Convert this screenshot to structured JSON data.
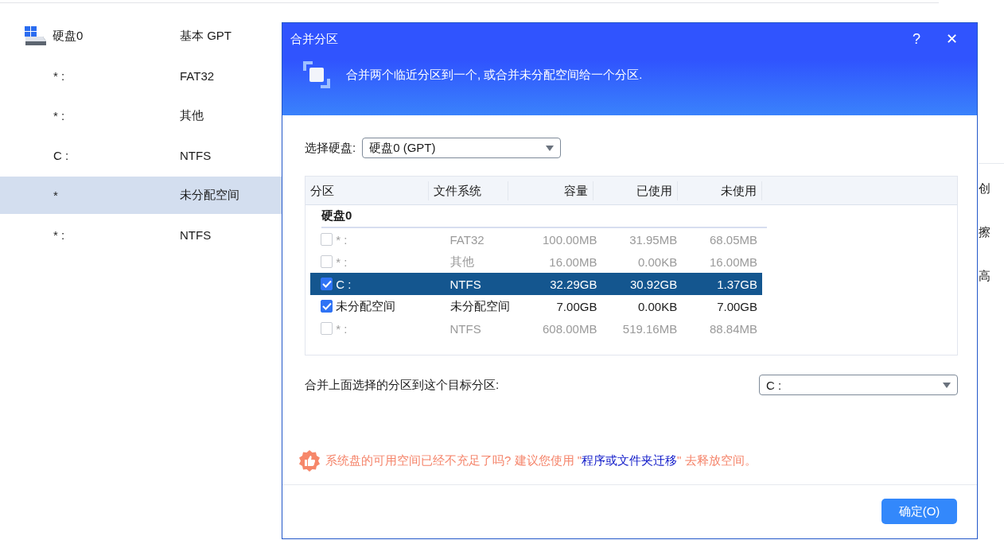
{
  "background_list": {
    "rows": [
      {
        "name": "硬盘0",
        "type": "基本 GPT",
        "kind": "disk",
        "selected": false
      },
      {
        "name": "* :",
        "type": "FAT32",
        "kind": "partition",
        "selected": false
      },
      {
        "name": "* :",
        "type": "其他",
        "kind": "partition",
        "selected": false
      },
      {
        "name": "C :",
        "type": "NTFS",
        "kind": "partition",
        "selected": false
      },
      {
        "name": "*",
        "type": "未分配空间",
        "kind": "partition",
        "selected": true
      },
      {
        "name": "* :",
        "type": "NTFS",
        "kind": "partition",
        "selected": false
      }
    ]
  },
  "side_menu": {
    "items": [
      "创",
      "擦",
      "高"
    ]
  },
  "dialog": {
    "title": "合并分区",
    "help": "?",
    "close": "✕",
    "banner": "合并两个临近分区到一个, 或合并未分配空间给一个分区.",
    "disk_label": "选择硬盘:",
    "disk_value": "硬盘0 (GPT)",
    "table": {
      "columns": [
        "分区",
        "文件系统",
        "容量",
        "已使用",
        "未使用"
      ],
      "group": "硬盘0",
      "rows": [
        {
          "cells": [
            "* :",
            "FAT32",
            "100.00MB",
            "31.95MB",
            "68.05MB"
          ],
          "checked": false,
          "disabled": true,
          "selected": false
        },
        {
          "cells": [
            "* :",
            "其他",
            "16.00MB",
            "0.00KB",
            "16.00MB"
          ],
          "checked": false,
          "disabled": true,
          "selected": false
        },
        {
          "cells": [
            "C :",
            "NTFS",
            "32.29GB",
            "30.92GB",
            "1.37GB"
          ],
          "checked": true,
          "disabled": false,
          "selected": true
        },
        {
          "cells": [
            "未分配空间",
            "未分配空间",
            "7.00GB",
            "0.00KB",
            "7.00GB"
          ],
          "checked": true,
          "disabled": false,
          "selected": false
        },
        {
          "cells": [
            "* :",
            "NTFS",
            "608.00MB",
            "519.16MB",
            "88.84MB"
          ],
          "checked": false,
          "disabled": true,
          "selected": false
        }
      ]
    },
    "target_label": "合并上面选择的分区到这个目标分区:",
    "target_value": "C :",
    "tip": {
      "before": "系统盘的可用空间已经不充足了吗? 建议您使用 \"",
      "link": "程序或文件夹迁移",
      "after": "\" 去释放空间。"
    },
    "ok_button": "确定(O)"
  }
}
